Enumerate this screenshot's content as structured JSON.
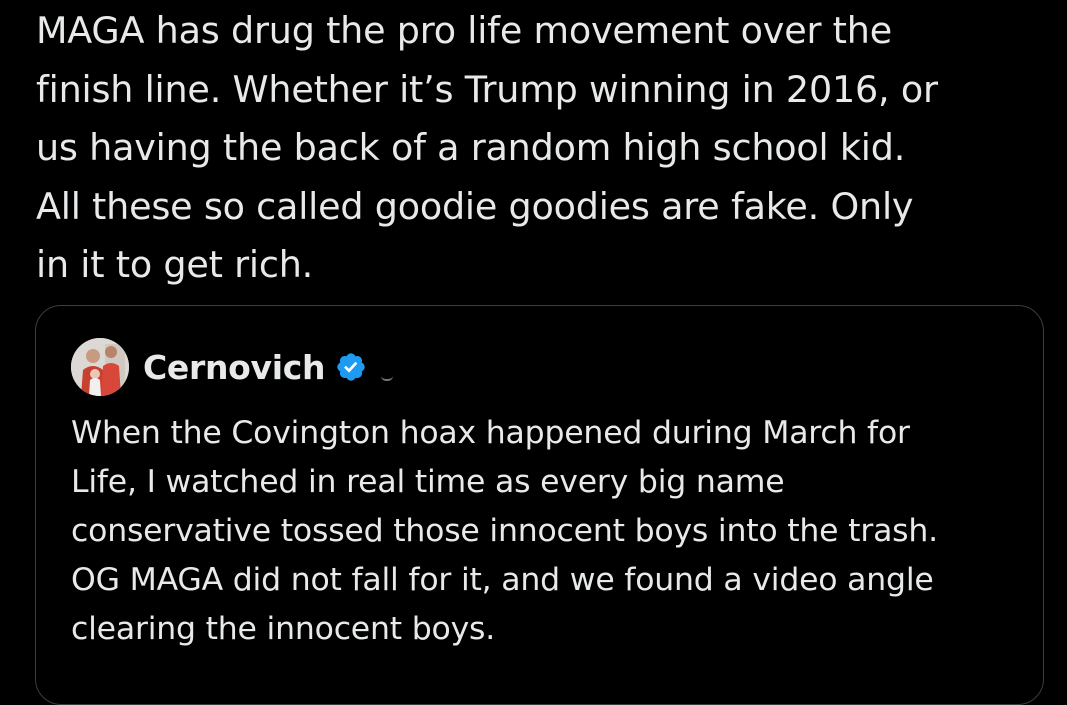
{
  "post": {
    "text_lines": [
      "MAGA has drug the pro life movement over the",
      "finish line. Whether it’s Trump winning in 2016, or",
      "us having the back of a random high school kid.",
      "All these so called goodie goodies are fake. Only",
      "in it to get rich."
    ]
  },
  "quoted_post": {
    "author_name": "Cernovich",
    "avatar_icon": "user-avatar",
    "verified_icon": "verified-badge-icon",
    "verified_color": "#1d9bf0",
    "text_lines": [
      "When the Covington hoax happened during March for",
      "Life, I watched in real time as every big name",
      "conservative tossed those innocent boys into the trash.",
      "OG MAGA did not fall for it, and we found a video angle",
      "clearing the innocent boys."
    ]
  },
  "colors": {
    "background": "#000000",
    "text": "#e7e9ea",
    "border": "#3a3d41",
    "muted": "#71767b"
  }
}
